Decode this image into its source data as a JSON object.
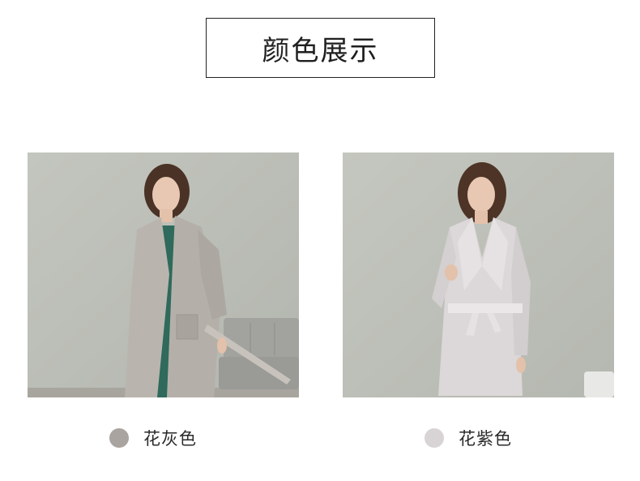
{
  "header": {
    "title": "颜色展示"
  },
  "variants": [
    {
      "label": "花灰色",
      "swatch_color": "#a9a4a0"
    },
    {
      "label": "花紫色",
      "swatch_color": "#d8d4d6"
    }
  ],
  "colors": {
    "wall": "#bcbfb8",
    "robe_grey": "#b9b5ae",
    "robe_light": "#dcd7d8",
    "inner_dress": "#2f6a5c",
    "sofa": "#9c9c98"
  }
}
